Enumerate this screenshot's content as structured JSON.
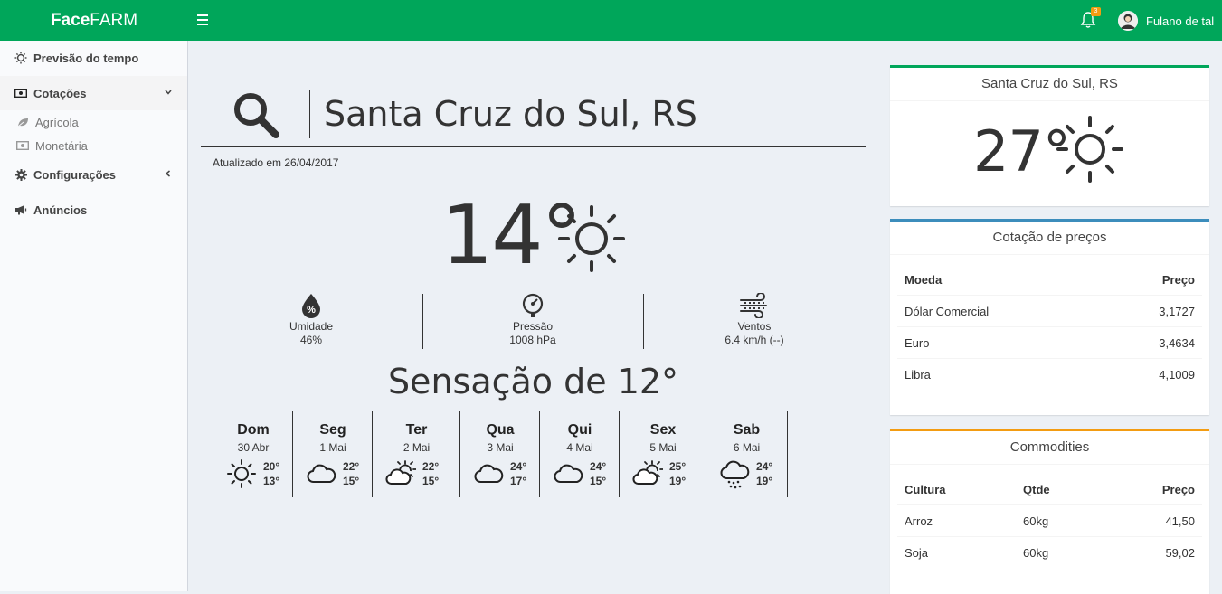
{
  "header": {
    "brand_bold": "Face",
    "brand_rest": "FARM",
    "notifications_count": "3",
    "user_name": "Fulano de tal",
    "accent_color": "#00a65a"
  },
  "sidebar": {
    "items": [
      {
        "label": "Previsão do tempo",
        "icon": "sun-outline-icon"
      },
      {
        "label": "Cotações",
        "icon": "money-icon",
        "caret": "chevron-down-icon"
      },
      {
        "label": "Configurações",
        "icon": "gear-icon",
        "caret": "chevron-left-icon"
      },
      {
        "label": "Anúncios",
        "icon": "megaphone-icon"
      }
    ],
    "subitems": [
      {
        "label": "Agrícola",
        "icon": "leaf-icon"
      },
      {
        "label": "Monetária",
        "icon": "money-icon"
      }
    ]
  },
  "weather": {
    "city": "Santa Cruz do Sul, RS",
    "updated": "Atualizado em 26/04/2017",
    "temperature": "14°",
    "humidity_label": "Umidade",
    "humidity_value": "46%",
    "pressure_label": "Pressão",
    "pressure_value": "1008 hPa",
    "wind_label": "Ventos",
    "wind_value": "6.4 km/h (--)",
    "feels_like": "Sensação de 12°"
  },
  "forecast": [
    {
      "day": "Dom",
      "date": "30 Abr",
      "hi": "20°",
      "lo": "13°",
      "icon": "sunny-icon"
    },
    {
      "day": "Seg",
      "date": "1 Mai",
      "hi": "22°",
      "lo": "15°",
      "icon": "cloud-icon"
    },
    {
      "day": "Ter",
      "date": "2 Mai",
      "hi": "22°",
      "lo": "15°",
      "icon": "partly-cloudy-icon"
    },
    {
      "day": "Qua",
      "date": "3 Mai",
      "hi": "24°",
      "lo": "17°",
      "icon": "cloud-icon"
    },
    {
      "day": "Qui",
      "date": "4 Mai",
      "hi": "24°",
      "lo": "15°",
      "icon": "cloud-icon"
    },
    {
      "day": "Sex",
      "date": "5 Mai",
      "hi": "25°",
      "lo": "19°",
      "icon": "partly-cloudy-icon"
    },
    {
      "day": "Sab",
      "date": "6 Mai",
      "hi": "24°",
      "lo": "19°",
      "icon": "rain-cloud-icon"
    }
  ],
  "widgets": {
    "city_box": {
      "title": "Santa Cruz do Sul, RS",
      "temperature": "27°",
      "border_color": "#00a65a"
    },
    "prices_box": {
      "title": "Cotação de preços",
      "border_color": "#3c8dbc",
      "headers": [
        "Moeda",
        "Preço"
      ],
      "rows": [
        [
          "Dólar Comercial",
          "3,1727"
        ],
        [
          "Euro",
          "3,4634"
        ],
        [
          "Libra",
          "4,1009"
        ]
      ]
    },
    "commodities_box": {
      "title": "Commodities",
      "border_color": "#f39c12",
      "headers": [
        "Cultura",
        "Qtde",
        "Preço"
      ],
      "rows": [
        [
          "Arroz",
          "60kg",
          "41,50"
        ],
        [
          "Soja",
          "60kg",
          "59,02"
        ]
      ]
    }
  }
}
